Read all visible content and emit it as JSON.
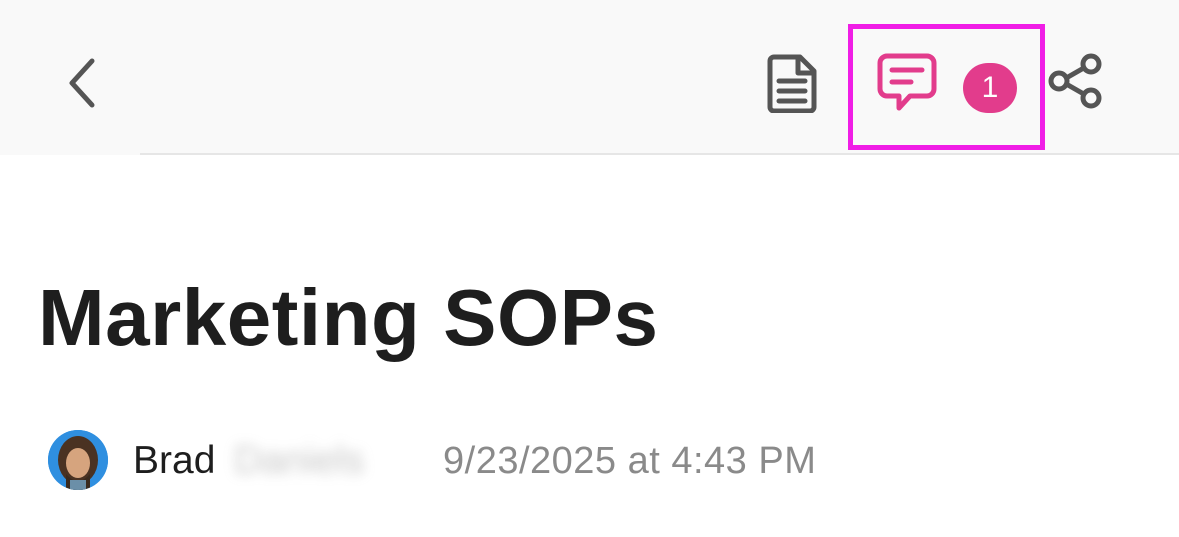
{
  "header": {
    "back_icon": "chevron-left-icon",
    "doc_icon": "document-icon",
    "comment_icon": "comment-icon",
    "comment_count": "1",
    "share_icon": "share-icon",
    "accent_color": "#e23c8c",
    "highlight_color": "#f01ee6"
  },
  "document": {
    "title": "Marketing SOPs",
    "author_first": "Brad",
    "author_last": "Daniels",
    "timestamp": "9/23/2025 at 4:43 PM"
  }
}
